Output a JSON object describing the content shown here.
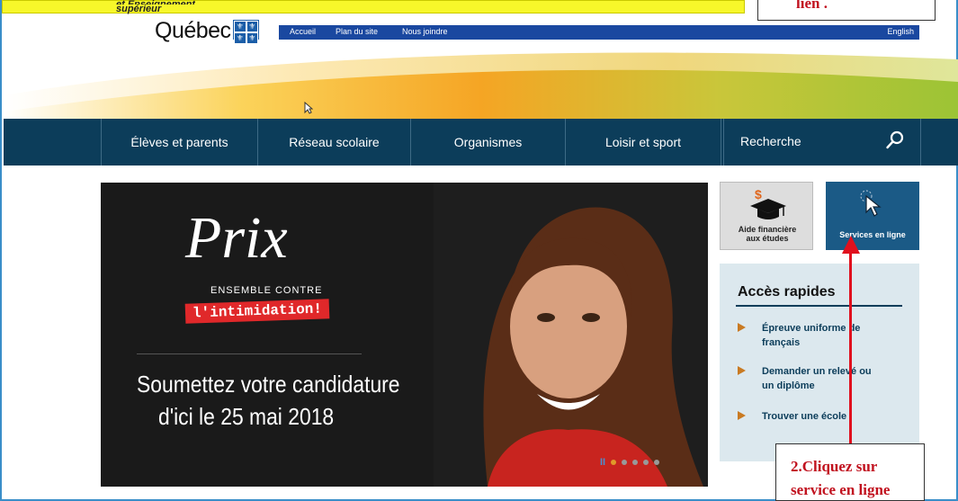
{
  "header": {
    "ministry_line1": "et Enseignement",
    "ministry_line2": "supérieur",
    "brand": "Québec",
    "links": [
      "Accueil",
      "Plan du site",
      "Nous joindre"
    ],
    "english": "English"
  },
  "annotations": {
    "top_right": "lien .",
    "bottom_right_line1": "2.Cliquez sur",
    "bottom_right_line2": "service en ligne",
    "colors": {
      "annotation_red": "#c1121f",
      "arrow_red": "#e0101e",
      "note_yellow": "#f7f72a"
    }
  },
  "nav": {
    "items": [
      "Élèves et parents",
      "Réseau scolaire",
      "Organismes",
      "Loisir et sport"
    ],
    "search_label": "Recherche",
    "search_icon": "search-icon"
  },
  "hero": {
    "title": "Prix",
    "ensemble": "ENSEMBLE CONTRE",
    "intimidation": "l'intimidation!",
    "line1": "Soumettez votre candidature",
    "line2": "d'ici le 25 mai 2018",
    "carousel_pause": "II",
    "carousel_dots": 5,
    "carousel_active": 1
  },
  "tiles": {
    "aide_line1": "Aide financière",
    "aide_line2": "aux études",
    "services": "Services en ligne"
  },
  "quick_access": {
    "title": "Accès rapides",
    "items": [
      {
        "line1": "Épreuve uniforme de",
        "line2": "français"
      },
      {
        "line1": "Demander un relevé ou",
        "line2": "un diplôme"
      },
      {
        "line1": "Trouver une école",
        "line2": ""
      }
    ]
  }
}
